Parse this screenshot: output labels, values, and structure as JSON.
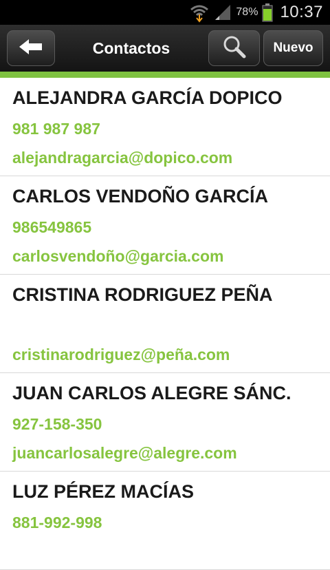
{
  "status_bar": {
    "battery_percent": "78%",
    "time": "10:37"
  },
  "action_bar": {
    "title": "Contactos",
    "new_button_label": "Nuevo"
  },
  "contacts": [
    {
      "name": "ALEJANDRA GARCÍA DOPICO",
      "phone": "981 987 987",
      "email": "alejandragarcia@dopico.com"
    },
    {
      "name": "CARLOS VENDOÑO GARCÍA",
      "phone": "986549865",
      "email": "carlosvendoño@garcia.com"
    },
    {
      "name": "CRISTINA RODRIGUEZ PEÑA",
      "phone": "",
      "email": "cristinarodriguez@peña.com"
    },
    {
      "name": "JUAN CARLOS ALEGRE SÁNC.",
      "phone": "927-158-350",
      "email": "juancarlosalegre@alegre.com"
    },
    {
      "name": "LUZ PÉREZ MACÍAS",
      "phone": "881-992-998",
      "email": ""
    }
  ],
  "colors": {
    "accent": "#7fc241",
    "contact_detail": "#86c43f",
    "name_text": "#1a1a1a"
  }
}
